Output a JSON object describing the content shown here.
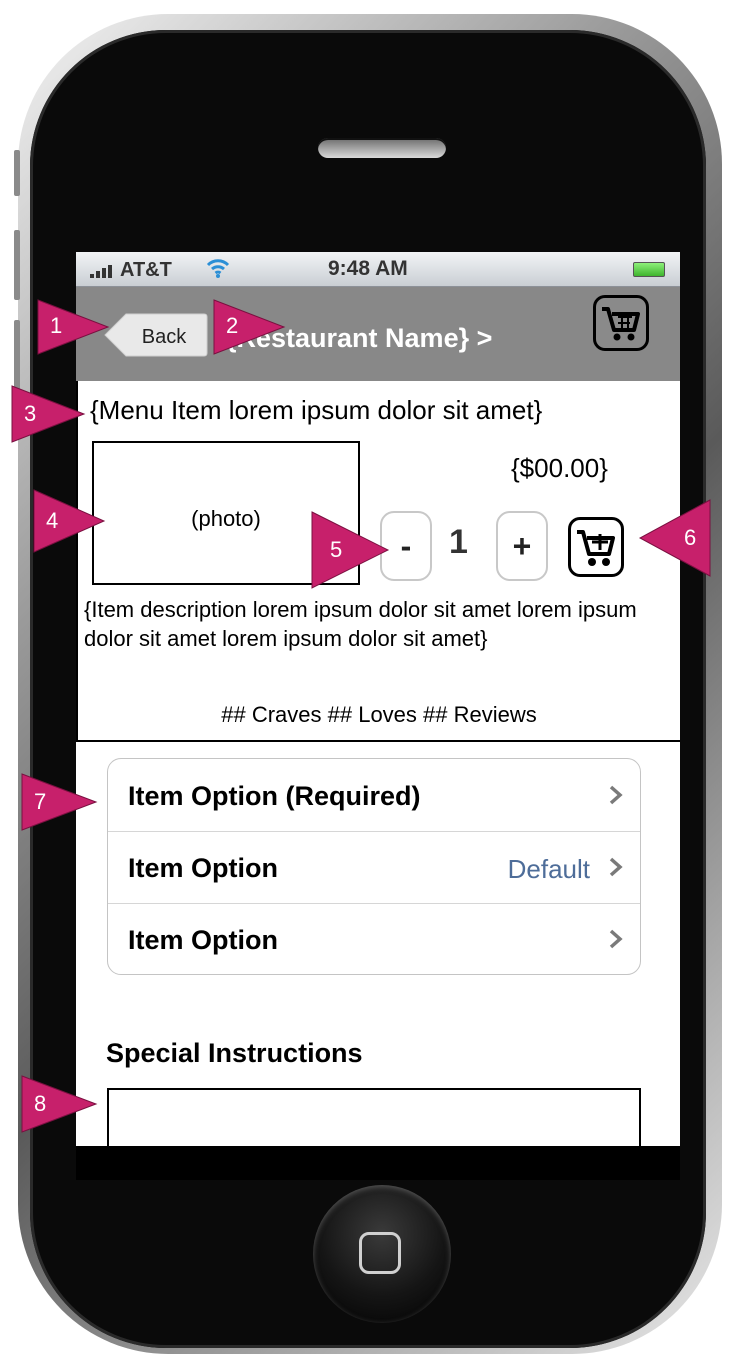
{
  "status_bar": {
    "carrier": "AT&T",
    "time": "9:48 AM"
  },
  "nav": {
    "back_label": "Back",
    "title": "{Restaurant Name} >"
  },
  "item": {
    "title": "{Menu Item lorem ipsum dolor sit amet}",
    "photo_label": "(photo)",
    "price": "{$00.00}",
    "qty_minus": "-",
    "qty": "1",
    "qty_plus": "+",
    "description": "{Item description lorem ipsum dolor sit amet lorem ipsum dolor sit amet lorem ipsum dolor sit amet}",
    "stats": "## Craves  ## Loves  ## Reviews"
  },
  "options": [
    {
      "label": "Item Option (Required)",
      "value": ""
    },
    {
      "label": "Item Option",
      "value": "Default"
    },
    {
      "label": "Item Option",
      "value": ""
    }
  ],
  "special_instructions": {
    "label": "Special Instructions",
    "value": ""
  },
  "annotations": [
    "1",
    "2",
    "3",
    "4",
    "5",
    "6",
    "7",
    "8"
  ],
  "colors": {
    "annotation": "#c7206b",
    "nav_bg": "#888888",
    "option_value": "#4e6d99"
  }
}
